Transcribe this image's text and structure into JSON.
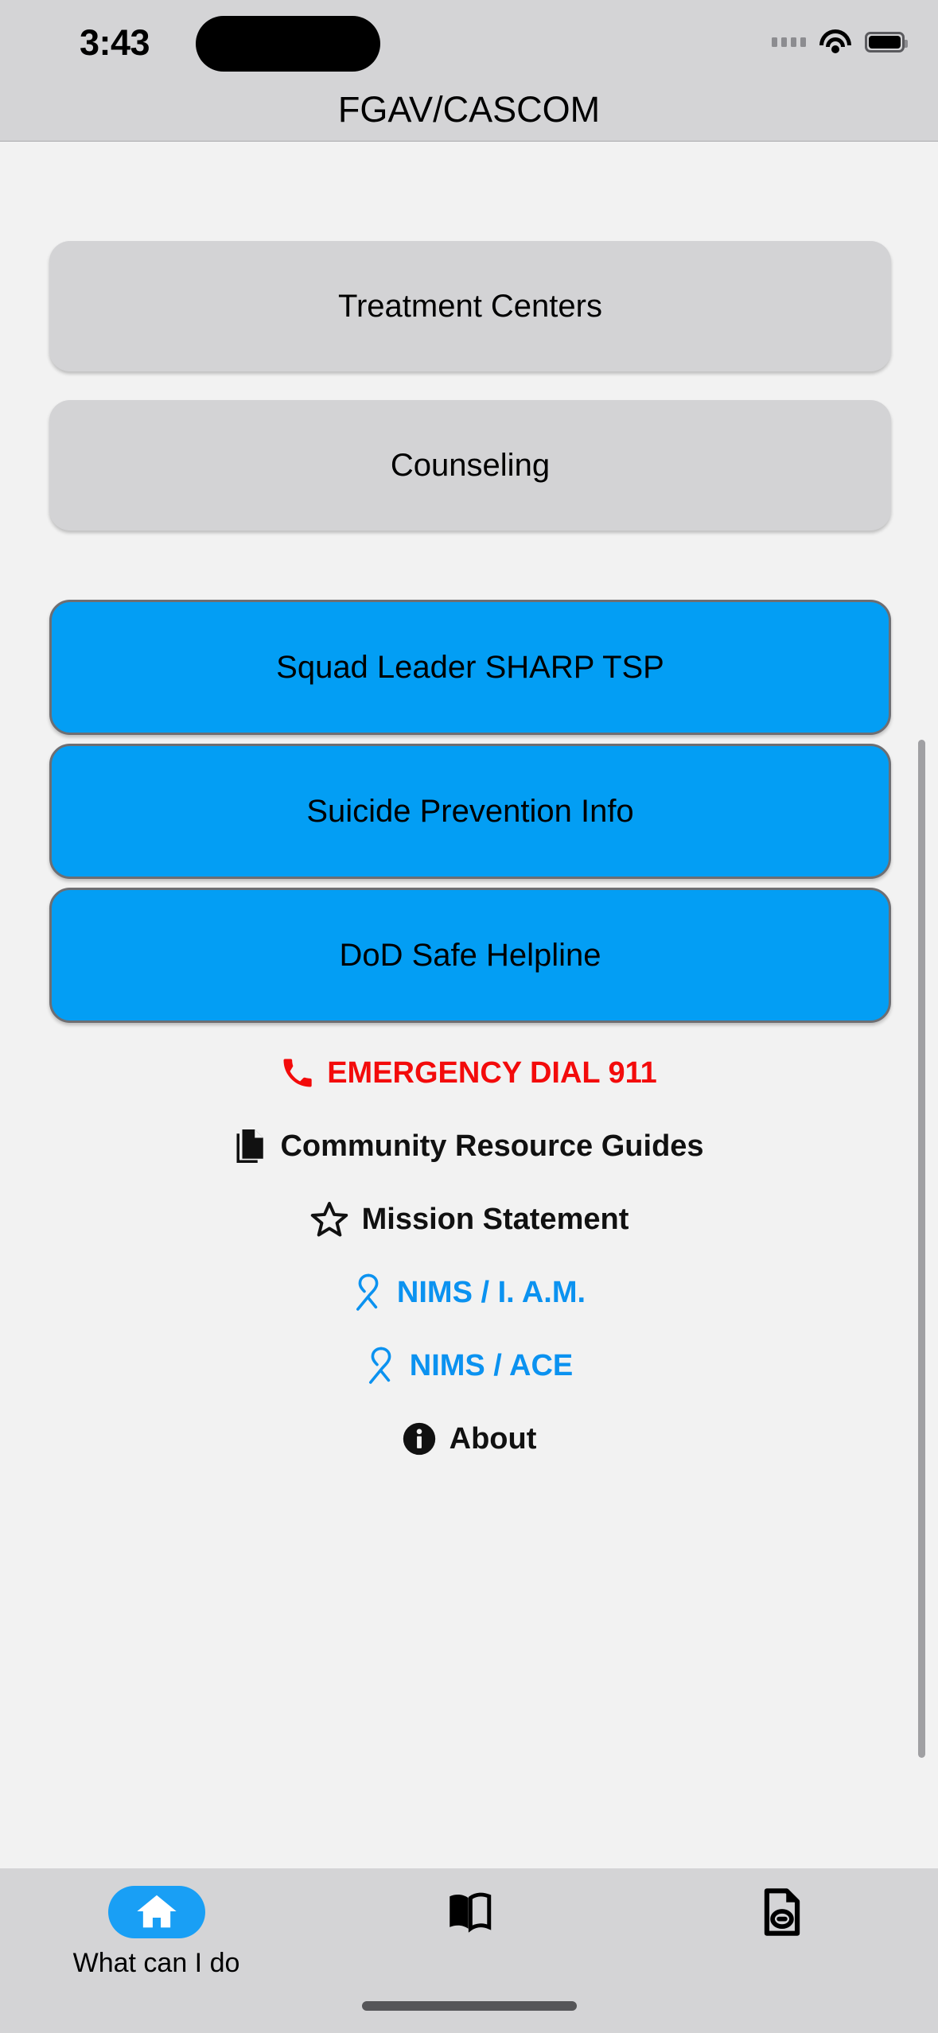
{
  "status_bar": {
    "time": "3:43",
    "signal_icon": "cellular-dots-icon",
    "wifi_icon": "wifi-icon",
    "battery_icon": "battery-icon"
  },
  "header": {
    "title": "FGAV/CASCOM"
  },
  "buttons": [
    {
      "label": "Treatment Centers",
      "style": "gray"
    },
    {
      "label": "Counseling",
      "style": "gray"
    },
    {
      "label": "Squad Leader SHARP TSP",
      "style": "blue"
    },
    {
      "label": "Suicide Prevention Info",
      "style": "blue"
    },
    {
      "label": "DoD Safe Helpline",
      "style": "blue"
    }
  ],
  "links": [
    {
      "label": "EMERGENCY DIAL 911",
      "icon": "phone-icon",
      "color": "#f30b0b"
    },
    {
      "label": "Community Resource Guides",
      "icon": "documents-icon",
      "color": "#111111"
    },
    {
      "label": "Mission Statement",
      "icon": "star-icon",
      "color": "#111111"
    },
    {
      "label": "NIMS / I. A.M.",
      "icon": "ribbon-icon",
      "color": "#0b92f0"
    },
    {
      "label": "NIMS / ACE",
      "icon": "ribbon-icon",
      "color": "#0b92f0"
    },
    {
      "label": "About",
      "icon": "info-icon",
      "color": "#111111"
    }
  ],
  "tabs": [
    {
      "label": "What can I do",
      "icon": "home-icon",
      "active": true
    },
    {
      "label": "",
      "icon": "open-book-icon",
      "active": false
    },
    {
      "label": "",
      "icon": "document-link-icon",
      "active": false
    }
  ],
  "colors": {
    "accent_blue": "#039ef4",
    "tab_active_blue": "#199ff5",
    "emergency_red": "#f30b0b",
    "link_blue": "#0b92f0",
    "gray_button": "#d3d3d5",
    "chrome_gray": "#d4d4d6",
    "page_bg": "#f2f2f2"
  }
}
